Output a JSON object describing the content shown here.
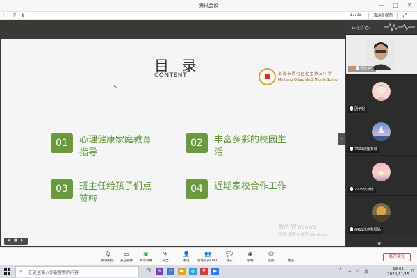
{
  "window": {
    "title": "腾讯会议"
  },
  "topbar": {
    "timer": "27:23",
    "view_button": "演讲者视图"
  },
  "slide": {
    "title": "目 录",
    "subtitle": "CONTENT",
    "school_cn": "上海市闵行区七宝第三中学",
    "school_en": "Minhang Qibao No.3 Middle School",
    "items": [
      {
        "num": "01",
        "text": "心理健康家庭教育指导"
      },
      {
        "num": "02",
        "text": "丰富多彩的校园生活"
      },
      {
        "num": "03",
        "text": "班主任给孩子们点赞啦"
      },
      {
        "num": "04",
        "text": "近期家校合作工作"
      }
    ],
    "watermark_title": "激活 Windows",
    "watermark_sub": "转到\"设置\"以激活 Windows。"
  },
  "panel": {
    "speaking_label": "正在讲话:",
    "participants": [
      {
        "name": "大球学妈"
      },
      {
        "name": "因子姐"
      },
      {
        "name": "7501沈塑石城"
      },
      {
        "name": "7725沈对怡"
      },
      {
        "name": "6411沈佳慧妈妈"
      }
    ]
  },
  "controls": {
    "items": [
      {
        "label": "解除静音",
        "icon": "mic-off-icon"
      },
      {
        "label": "开启视频",
        "icon": "camera-off-icon"
      },
      {
        "label": "共享屏幕",
        "icon": "share-screen-icon"
      },
      {
        "label": "安全",
        "icon": "shield-icon"
      },
      {
        "label": "邀请",
        "icon": "invite-icon"
      },
      {
        "label": "管理成员(243)",
        "icon": "members-icon"
      },
      {
        "label": "聊天",
        "icon": "chat-icon"
      },
      {
        "label": "录制",
        "icon": "record-icon"
      },
      {
        "label": "美颜",
        "icon": "beauty-icon"
      },
      {
        "label": "更多",
        "icon": "more-icon"
      }
    ],
    "leave": "离开会议"
  },
  "taskbar": {
    "search_placeholder": "在这里输入你要搜索的内容",
    "lang": "英",
    "time": "19:01",
    "date": "2020/11/15"
  },
  "colors": {
    "accent_green": "#6a9a3c",
    "leave_red": "#e04848"
  }
}
